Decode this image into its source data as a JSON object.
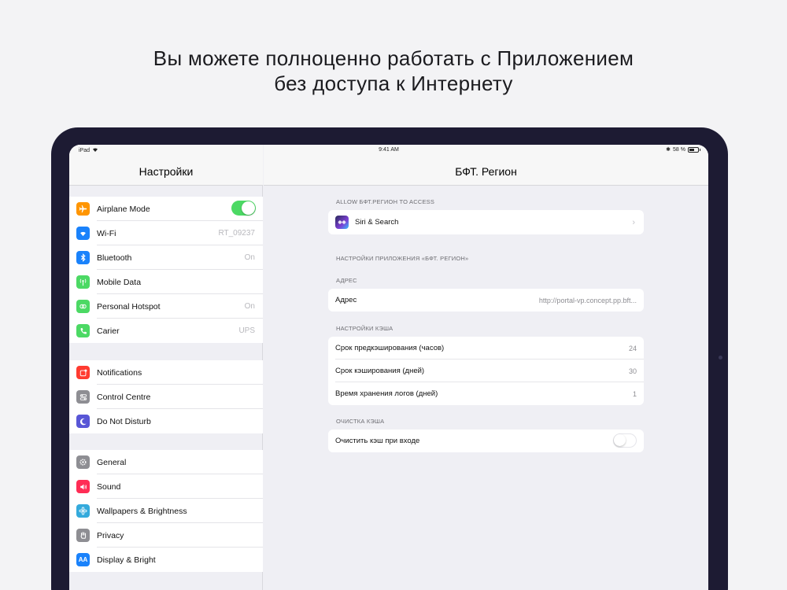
{
  "headline": {
    "line1": "Вы можете полноценно работать с Приложением",
    "line2": "без доступа к Интернету"
  },
  "status_bar": {
    "device": "iPad",
    "time": "9:41 AM",
    "battery": "58 %"
  },
  "master": {
    "title": "Настройки",
    "groups": [
      [
        {
          "label": "Airplane Mode",
          "icon": "airplane-icon",
          "color": "#ff9500",
          "toggle": "on"
        },
        {
          "label": "Wi-Fi",
          "icon": "wifi-icon",
          "color": "#1a82fb",
          "value": "RT_09237"
        },
        {
          "label": "Bluetooth",
          "icon": "bluetooth-icon",
          "color": "#1a82fb",
          "value": "On"
        },
        {
          "label": "Mobile Data",
          "icon": "antenna-icon",
          "color": "#4cd964"
        },
        {
          "label": "Personal Hotspot",
          "icon": "hotspot-icon",
          "color": "#4cd964",
          "value": "On"
        },
        {
          "label": "Carier",
          "icon": "phone-icon",
          "color": "#4cd964",
          "value": "UPS"
        }
      ],
      [
        {
          "label": "Notifications",
          "icon": "notifications-icon",
          "color": "#ff3b30"
        },
        {
          "label": "Control Centre",
          "icon": "control-centre-icon",
          "color": "#8e8e93"
        },
        {
          "label": "Do Not Disturb",
          "icon": "moon-icon",
          "color": "#5856d6"
        }
      ],
      [
        {
          "label": "General",
          "icon": "gear-icon",
          "color": "#8e8e93"
        },
        {
          "label": "Sound",
          "icon": "speaker-icon",
          "color": "#ff2d55"
        },
        {
          "label": "Wallpapers & Brightness",
          "icon": "flower-icon",
          "color": "#34aadc"
        },
        {
          "label": "Privacy",
          "icon": "hand-icon",
          "color": "#8e8e93"
        },
        {
          "label": "Display & Bright",
          "icon": "text-size-icon",
          "color": "#1a82fb"
        }
      ]
    ]
  },
  "detail": {
    "title": "БФТ. Регион",
    "allow_header": "ALLOW БФТ.РЕГИОН TO ACCESS",
    "siri_label": "Siri & Search",
    "app_settings_header": "НАСТРОЙКИ ПРИЛОЖЕНИЯ «БФТ. РЕГИОН»",
    "address_header": "АДРЕС",
    "address_label": "Адрес",
    "address_value": "http://portal-vp.concept.pp.bft...",
    "cache_header": "НАСТРОЙКИ КЭША",
    "cache_rows": [
      {
        "label": "Срок предкэширования (часов)",
        "value": "24"
      },
      {
        "label": "Срок кэширования (дней)",
        "value": "30"
      },
      {
        "label": "Время хранения логов (дней)",
        "value": "1"
      }
    ],
    "clear_header": "ОЧИСТКА КЭША",
    "clear_label": "Очистить кэш при входе",
    "clear_toggle": "off"
  }
}
